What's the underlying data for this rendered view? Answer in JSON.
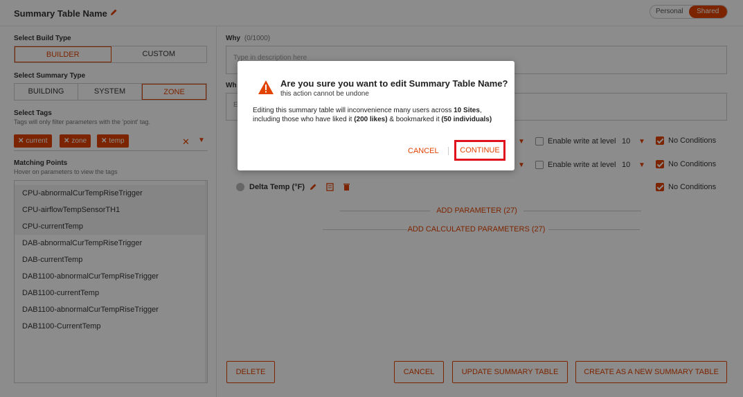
{
  "header": {
    "title": "Summary Table Name",
    "toggle": [
      "Personal",
      "Shared"
    ],
    "toggle_selected": "Shared"
  },
  "left": {
    "build_type_label": "Select Build Type",
    "build_types": [
      "BUILDER",
      "CUSTOM"
    ],
    "build_selected": "BUILDER",
    "summary_type_label": "Select Summary Type",
    "summary_types": [
      "BUILDING",
      "SYSTEM",
      "ZONE"
    ],
    "summary_selected": "ZONE",
    "tags_label": "Select Tags",
    "tags_hint": "Tags will only filter parameters with the 'point' tag.",
    "tags": [
      "current",
      "zone",
      "temp"
    ],
    "matching_label": "Matching Points",
    "matching_hint": "Hover on parameters to view the tags",
    "points": [
      "CPU-abnormalCurTempRiseTrigger",
      "CPU-airflowTempSensorTH1",
      "CPU-currentTemp",
      "DAB-abnormalCurTempRiseTrigger",
      "DAB-currentTemp",
      "DAB1100-abnormalCurTempRiseTrigger",
      "DAB1100-currentTemp",
      "DAB1100-abnormalCurTempRiseTrigger",
      "DAB1100-CurrentTemp"
    ]
  },
  "right": {
    "why_label": "Why",
    "why_count": "(0/1000)",
    "why_placeholder": "Type in description here",
    "what_label": "Wh",
    "what_placeholder": "E",
    "param_rows": [
      {
        "enable_label": "Enable write at level",
        "level": "10",
        "no_conditions": "No Conditions"
      },
      {
        "enable_label": "Enable write at level",
        "level": "10",
        "no_conditions": "No Conditions"
      },
      {
        "name": "Delta Temp (°F)",
        "no_conditions": "No Conditions"
      }
    ],
    "add_parameter": "ADD PARAMETER (27)",
    "add_calculated": "ADD CALCULATED PARAMETERS (27)"
  },
  "footer": {
    "delete": "DELETE",
    "cancel": "CANCEL",
    "update": "UPDATE SUMMARY TABLE",
    "create_new": "CREATE AS A NEW SUMMARY TABLE"
  },
  "modal": {
    "title": "Are you sure you want to edit Summary Table Name?",
    "subtitle": "this action cannot be undone",
    "body_1": "Editing this summary table will inconvenience many users across ",
    "sites": "10 Sites",
    "body_2": ", including those who have liked it ",
    "likes": "(200 likes)",
    "body_3": " & bookmarked it ",
    "bookmarks": "(50 individuals)",
    "cancel": "CANCEL",
    "continue": "CONTINUE"
  },
  "colors": {
    "accent": "#e24301",
    "highlight_border": "#e0121d"
  }
}
